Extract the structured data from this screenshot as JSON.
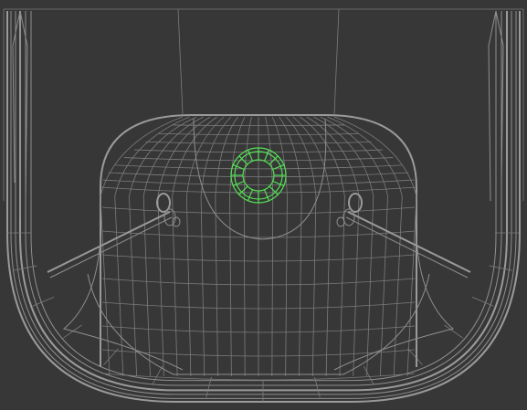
{
  "viewport": {
    "background": "#373737",
    "wire_color": "#8f8f8f",
    "selection_color": "#55e055"
  },
  "mesh": {
    "ring_segments": 16,
    "dome_meridians": 22,
    "dome_parallels": 9
  }
}
